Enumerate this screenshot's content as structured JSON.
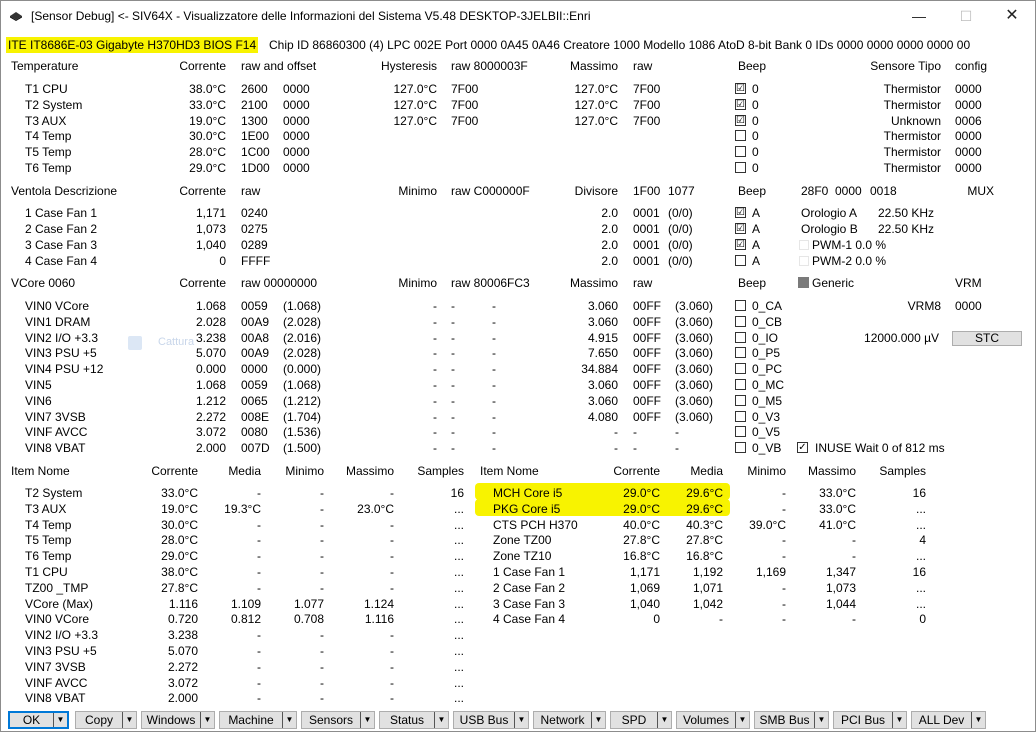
{
  "window": {
    "title": "[Sensor Debug] <- SIV64X - Visualizzatore delle Informazioni del Sistema V5.48 DESKTOP-3JELBII::Enri",
    "minimize": "—",
    "maximize": "☐",
    "close": "✕"
  },
  "info": {
    "chip": "ITE IT8686E-03 Gigabyte H370HD3 BIOS F14",
    "rest": "Chip ID 86860300 (4)  LPC 002E  Port 0000 0A45 0A46  Creatore 1000  Modello 1086  AtoD 8-bit  Bank 0  IDs 0000 0000 0000 0000 00"
  },
  "temps": {
    "headers": {
      "name": "Temperature",
      "cur": "Corrente",
      "raw": "raw and offset",
      "hyst": "Hysteresis",
      "hraw": "raw 8000003F",
      "max": "Massimo",
      "mraw": "raw",
      "beep": "Beep",
      "type": "Sensore Tipo",
      "cfg": "config"
    },
    "rows": [
      {
        "name": "T1 CPU",
        "cur": "38.0°C",
        "raw1": "2600",
        "raw2": "0000",
        "hyst": "127.0°C",
        "hraw": "7F00",
        "max": "127.0°C",
        "mraw": "7F00",
        "chk": "☑",
        "beep": "0",
        "type": "Thermistor",
        "cfg": "0000"
      },
      {
        "name": "T2 System",
        "cur": "33.0°C",
        "raw1": "2100",
        "raw2": "0000",
        "hyst": "127.0°C",
        "hraw": "7F00",
        "max": "127.0°C",
        "mraw": "7F00",
        "chk": "☑",
        "beep": "0",
        "type": "Thermistor",
        "cfg": "0000"
      },
      {
        "name": "T3 AUX",
        "cur": "19.0°C",
        "raw1": "1300",
        "raw2": "0000",
        "hyst": "127.0°C",
        "hraw": "7F00",
        "max": "127.0°C",
        "mraw": "7F00",
        "chk": "☑",
        "beep": "0",
        "type": "Unknown",
        "cfg": "0006"
      },
      {
        "name": "T4 Temp",
        "cur": "30.0°C",
        "raw1": "1E00",
        "raw2": "0000",
        "hyst": "",
        "hraw": "",
        "max": "",
        "mraw": "",
        "chk": "",
        "beep": "0",
        "type": "Thermistor",
        "cfg": "0000"
      },
      {
        "name": "T5 Temp",
        "cur": "28.0°C",
        "raw1": "1C00",
        "raw2": "0000",
        "hyst": "",
        "hraw": "",
        "max": "",
        "mraw": "",
        "chk": "",
        "beep": "0",
        "type": "Thermistor",
        "cfg": "0000"
      },
      {
        "name": "T6 Temp",
        "cur": "29.0°C",
        "raw1": "1D00",
        "raw2": "0000",
        "hyst": "",
        "hraw": "",
        "max": "",
        "mraw": "",
        "chk": "",
        "beep": "0",
        "type": "Thermistor",
        "cfg": "0000"
      }
    ]
  },
  "fans": {
    "headers": {
      "name": "Ventola Descrizione",
      "cur": "Corrente",
      "raw": "raw",
      "min": "Minimo",
      "mraw": "raw C000000F",
      "div": "Divisore",
      "d1": "1F00",
      "d2": "1077",
      "beep": "Beep",
      "x1": "28F0",
      "x2": "0000",
      "x3": "0018",
      "mux": "MUX"
    },
    "rows": [
      {
        "name": "1 Case Fan 1",
        "cur": "1,171",
        "raw": "0240",
        "div": "2.0",
        "d1": "0001",
        "d2": "(0/0)",
        "chk": "☑",
        "beep": "A"
      },
      {
        "name": "2 Case Fan 2",
        "cur": "1,073",
        "raw": "0275",
        "div": "2.0",
        "d1": "0001",
        "d2": "(0/0)",
        "chk": "☑",
        "beep": "A"
      },
      {
        "name": "3 Case Fan 3",
        "cur": "1,040",
        "raw": "0289",
        "div": "2.0",
        "d1": "0001",
        "d2": "(0/0)",
        "chk": "☑",
        "beep": "A"
      },
      {
        "name": "4 Case Fan 4",
        "cur": "0",
        "raw": "FFFF",
        "div": "2.0",
        "d1": "0001",
        "d2": "(0/0)",
        "chk": "",
        "beep": "A"
      }
    ],
    "clock_a_label": "Orologio A",
    "clock_a": "22.50 KHz",
    "clock_b_label": "Orologio B",
    "clock_b": "22.50 KHz",
    "pwm1": "PWM-1 0.0 %",
    "pwm2": "PWM-2 0.0 %"
  },
  "volts": {
    "headers": {
      "name": "VCore 0060",
      "cur": "Corrente",
      "raw": "raw 00000000",
      "min": "Minimo",
      "mraw": "raw 80006FC3",
      "max": "Massimo",
      "xraw": "raw",
      "beep": "Beep",
      "generic": "Generic",
      "vrm": "VRM"
    },
    "rows": [
      {
        "name": "VIN0 VCore",
        "cur": "1.068",
        "raw": "0059",
        "sc": "(1.068)",
        "min": "-",
        "m1": "-",
        "m2": "-",
        "max": "3.060",
        "x1": "00FF",
        "x2": "(3.060)",
        "beep": "0_CA"
      },
      {
        "name": "VIN1 DRAM",
        "cur": "2.028",
        "raw": "00A9",
        "sc": "(2.028)",
        "min": "-",
        "m1": "-",
        "m2": "-",
        "max": "3.060",
        "x1": "00FF",
        "x2": "(3.060)",
        "beep": "0_CB"
      },
      {
        "name": "VIN2 I/O +3.3",
        "cur": "3.238",
        "raw": "00A8",
        "sc": "(2.016)",
        "min": "-",
        "m1": "-",
        "m2": "-",
        "max": "4.915",
        "x1": "00FF",
        "x2": "(3.060)",
        "beep": "0_IO"
      },
      {
        "name": "VIN3 PSU +5",
        "cur": "5.070",
        "raw": "00A9",
        "sc": "(2.028)",
        "min": "-",
        "m1": "-",
        "m2": "-",
        "max": "7.650",
        "x1": "00FF",
        "x2": "(3.060)",
        "beep": "0_P5"
      },
      {
        "name": "VIN4 PSU +12",
        "cur": "0.000",
        "raw": "0000",
        "sc": "(0.000)",
        "min": "-",
        "m1": "-",
        "m2": "-",
        "max": "34.884",
        "x1": "00FF",
        "x2": "(3.060)",
        "beep": "0_PC"
      },
      {
        "name": "VIN5",
        "cur": "1.068",
        "raw": "0059",
        "sc": "(1.068)",
        "min": "-",
        "m1": "-",
        "m2": "-",
        "max": "3.060",
        "x1": "00FF",
        "x2": "(3.060)",
        "beep": "0_MC"
      },
      {
        "name": "VIN6",
        "cur": "1.212",
        "raw": "0065",
        "sc": "(1.212)",
        "min": "-",
        "m1": "-",
        "m2": "-",
        "max": "3.060",
        "x1": "00FF",
        "x2": "(3.060)",
        "beep": "0_M5"
      },
      {
        "name": "VIN7 3VSB",
        "cur": "2.272",
        "raw": "008E",
        "sc": "(1.704)",
        "min": "-",
        "m1": "-",
        "m2": "-",
        "max": "4.080",
        "x1": "00FF",
        "x2": "(3.060)",
        "beep": "0_V3"
      },
      {
        "name": "VINF AVCC",
        "cur": "3.072",
        "raw": "0080",
        "sc": "(1.536)",
        "min": "-",
        "m1": "-",
        "m2": "-",
        "max": "-",
        "x1": "-",
        "x2": "-",
        "beep": "0_V5"
      },
      {
        "name": "VIN8 VBAT",
        "cur": "2.000",
        "raw": "007D",
        "sc": "(1.500)",
        "min": "-",
        "m1": "-",
        "m2": "-",
        "max": "-",
        "x1": "-",
        "x2": "-",
        "beep": "0_VB"
      }
    ],
    "vrm_name": "VRM8",
    "vrm_val": "0000",
    "uv": "12000.000 µV",
    "stc": "STC",
    "inuse": "INUSE Wait 0 of 812 ms",
    "ghost": "Cattura"
  },
  "items_left": {
    "headers": {
      "name": "Item Nome",
      "cur": "Corrente",
      "avg": "Media",
      "min": "Minimo",
      "max": "Massimo",
      "samples": "Samples"
    },
    "rows": [
      {
        "name": "T2 System",
        "cur": "33.0°C",
        "avg": "-",
        "min": "-",
        "max": "-",
        "samples": "16"
      },
      {
        "name": "T3 AUX",
        "cur": "19.0°C",
        "avg": "19.3°C",
        "min": "-",
        "max": "23.0°C",
        "samples": "..."
      },
      {
        "name": "T4 Temp",
        "cur": "30.0°C",
        "avg": "-",
        "min": "-",
        "max": "-",
        "samples": "..."
      },
      {
        "name": "T5 Temp",
        "cur": "28.0°C",
        "avg": "-",
        "min": "-",
        "max": "-",
        "samples": "..."
      },
      {
        "name": "T6 Temp",
        "cur": "29.0°C",
        "avg": "-",
        "min": "-",
        "max": "-",
        "samples": "..."
      },
      {
        "name": "T1 CPU",
        "cur": "38.0°C",
        "avg": "-",
        "min": "-",
        "max": "-",
        "samples": "..."
      },
      {
        "name": "TZ00 _TMP",
        "cur": "27.8°C",
        "avg": "-",
        "min": "-",
        "max": "-",
        "samples": "..."
      },
      {
        "name": "VCore (Max)",
        "cur": "1.116",
        "avg": "1.109",
        "min": "1.077",
        "max": "1.124",
        "samples": "..."
      },
      {
        "name": "VIN0 VCore",
        "cur": "0.720",
        "avg": "0.812",
        "min": "0.708",
        "max": "1.116",
        "samples": "..."
      },
      {
        "name": "VIN2 I/O +3.3",
        "cur": "3.238",
        "avg": "-",
        "min": "-",
        "max": "-",
        "samples": "..."
      },
      {
        "name": "VIN3 PSU +5",
        "cur": "5.070",
        "avg": "-",
        "min": "-",
        "max": "-",
        "samples": "..."
      },
      {
        "name": "VIN7 3VSB",
        "cur": "2.272",
        "avg": "-",
        "min": "-",
        "max": "-",
        "samples": "..."
      },
      {
        "name": "VINF AVCC",
        "cur": "3.072",
        "avg": "-",
        "min": "-",
        "max": "-",
        "samples": "..."
      },
      {
        "name": "VIN8 VBAT",
        "cur": "2.000",
        "avg": "-",
        "min": "-",
        "max": "-",
        "samples": "..."
      }
    ]
  },
  "items_right": {
    "headers": {
      "name": "Item Nome",
      "cur": "Corrente",
      "avg": "Media",
      "min": "Minimo",
      "max": "Massimo",
      "samples": "Samples"
    },
    "rows": [
      {
        "name": "MCH Core i5",
        "cur": "29.0°C",
        "avg": "29.6°C",
        "min": "-",
        "max": "33.0°C",
        "samples": "16"
      },
      {
        "name": "PKG Core i5",
        "cur": "29.0°C",
        "avg": "29.6°C",
        "min": "-",
        "max": "33.0°C",
        "samples": "..."
      },
      {
        "name": "CTS PCH H370",
        "cur": "40.0°C",
        "avg": "40.3°C",
        "min": "39.0°C",
        "max": "41.0°C",
        "samples": "..."
      },
      {
        "name": "Zone TZ00",
        "cur": "27.8°C",
        "avg": "27.8°C",
        "min": "-",
        "max": "-",
        "samples": "4"
      },
      {
        "name": "Zone TZ10",
        "cur": "16.8°C",
        "avg": "16.8°C",
        "min": "-",
        "max": "-",
        "samples": "..."
      },
      {
        "name": "1 Case Fan 1",
        "cur": "1,171",
        "avg": "1,192",
        "min": "1,169",
        "max": "1,347",
        "samples": "16"
      },
      {
        "name": "2 Case Fan 2",
        "cur": "1,069",
        "avg": "1,071",
        "min": "-",
        "max": "1,073",
        "samples": "..."
      },
      {
        "name": "3 Case Fan 3",
        "cur": "1,040",
        "avg": "1,042",
        "min": "-",
        "max": "1,044",
        "samples": "..."
      },
      {
        "name": "4 Case Fan 4",
        "cur": "0",
        "avg": "-",
        "min": "-",
        "max": "-",
        "samples": "0"
      }
    ]
  },
  "buttons": [
    "OK",
    "Copy",
    "Windows",
    "Machine",
    "Sensors",
    "Status",
    "USB Bus",
    "Network",
    "SPD",
    "Volumes",
    "SMB Bus",
    "PCI Bus",
    "ALL Dev"
  ],
  "colors": {
    "highlight": "#f8f300",
    "generic_square": "#7a7a7a",
    "stc_bg": "#e1e1e1",
    "ok_border": "#0078d7"
  }
}
